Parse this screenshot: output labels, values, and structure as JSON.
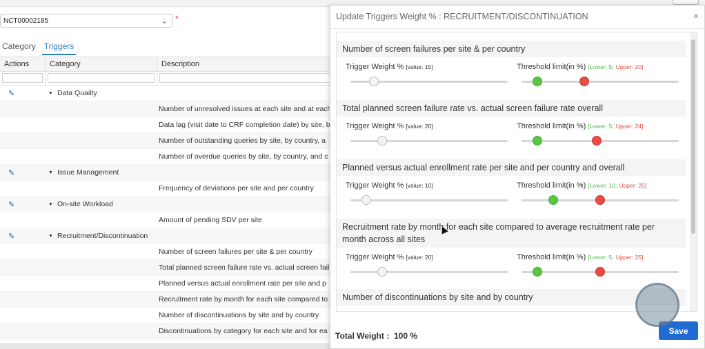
{
  "page": {
    "study_select_value": "NCT00002185",
    "required_marker": "*",
    "tabs": [
      {
        "label": "Category"
      },
      {
        "label": "Triggers",
        "active": true
      }
    ],
    "grid": {
      "columns": [
        "Actions",
        "Category",
        "Description"
      ],
      "rows": [
        {
          "category": "Data Quailty",
          "description": "",
          "group": true
        },
        {
          "category": "",
          "description": "Number of unresolved issues at each site and at each"
        },
        {
          "category": "",
          "description": "Data lag (visit date to CRF completion date) by site, by"
        },
        {
          "category": "",
          "description": "Number of outstanding queries by site, by country, a"
        },
        {
          "category": "",
          "description": "Number of overdue queries by site, by country, and c"
        },
        {
          "category": "Issue Management",
          "description": "",
          "group": true
        },
        {
          "category": "",
          "description": "Frequency of deviations per site and per country"
        },
        {
          "category": "On-site Workload",
          "description": "",
          "group": true
        },
        {
          "category": "",
          "description": "Amount of pending SDV per site"
        },
        {
          "category": "Recruitment/Discontinuation",
          "description": "",
          "group": true
        },
        {
          "category": "",
          "description": "Number of screen failures per site & per country"
        },
        {
          "category": "",
          "description": "Total planned screen failure rate vs. actual screen fail"
        },
        {
          "category": "",
          "description": "Planned versus actual enrollment rate per site and p"
        },
        {
          "category": "",
          "description": "Recruitment rate by month for each site compared to"
        },
        {
          "category": "",
          "description": "Number of discontinuations by site and by country"
        },
        {
          "category": "",
          "description": "Discontinuations by category for each site and for ea"
        }
      ]
    }
  },
  "modal": {
    "title": "Update Triggers Weight % : RECRUITMENT/DISCONTINUATION",
    "close": "×",
    "trigger_weight_label": "Trigger Weight %",
    "threshold_label": "Threshold limit(in %)",
    "triggers": [
      {
        "title": "Number of screen failures per site & per country",
        "value_text": "[value: 15]",
        "lower_text": "[Lower: 5;",
        "upper_text": "Upper: 20]",
        "weight": 15,
        "lower": 5,
        "upper": 20
      },
      {
        "title": "Total planned screen failure rate vs. actual screen failure rate overall",
        "value_text": "[value: 20]",
        "lower_text": "[Lower: 5;",
        "upper_text": "Upper: 24]",
        "weight": 20,
        "lower": 5,
        "upper": 24
      },
      {
        "title": "Planned versus actual enrollment rate per site and per country and overall",
        "value_text": "[value: 10]",
        "lower_text": "[Lower: 10;",
        "upper_text": "Upper: 25]",
        "weight": 10,
        "lower": 10,
        "upper": 25
      },
      {
        "title": "Recruitment rate by month for each site compared to average recruitment rate per month across all sites",
        "value_text": "[value: 20]",
        "lower_text": "[Lower: 5;",
        "upper_text": "Upper: 25]",
        "weight": 20,
        "lower": 5,
        "upper": 25
      },
      {
        "title": "Number of discontinuations by site and by country"
      }
    ],
    "total_weight_label": "Total Weight :",
    "total_weight_value": "100 %",
    "save_label": "Save"
  },
  "colors": {
    "accent": "#1f6bd1",
    "lower": "#4cc24c",
    "upper": "#e5493c",
    "tab_active": "#2a7fc1"
  }
}
